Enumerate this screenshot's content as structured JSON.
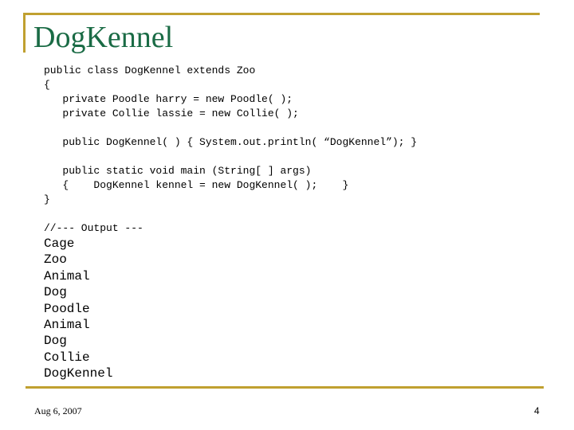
{
  "slide": {
    "title": "DogKennel",
    "code_lines": [
      "public class DogKennel extends Zoo",
      "{",
      "   private Poodle harry = new Poodle( );",
      "   private Collie lassie = new Collie( );",
      "",
      "   public DogKennel( ) { System.out.println( “DogKennel”); }",
      "",
      "   public static void main (String[ ] args)",
      "   {    DogKennel kennel = new DogKennel( );    }",
      "}"
    ],
    "output_header": "//--- Output ---",
    "output_lines": [
      "Cage",
      "Zoo",
      "Animal",
      "Dog",
      "Poodle",
      "Animal",
      "Dog",
      "Collie",
      "DogKennel"
    ]
  },
  "footer": {
    "date": "Aug 6, 2007",
    "page_number": "4"
  },
  "colors": {
    "accent_rule": "#c0a030",
    "title": "#1a6b45"
  }
}
